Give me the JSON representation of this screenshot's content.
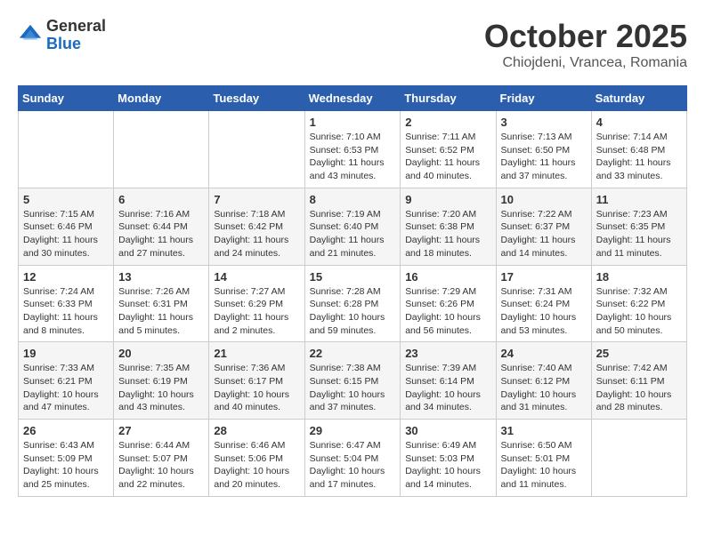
{
  "header": {
    "logo_general": "General",
    "logo_blue": "Blue",
    "month_title": "October 2025",
    "location": "Chiojdeni, Vrancea, Romania"
  },
  "weekdays": [
    "Sunday",
    "Monday",
    "Tuesday",
    "Wednesday",
    "Thursday",
    "Friday",
    "Saturday"
  ],
  "weeks": [
    [
      {
        "day": "",
        "info": ""
      },
      {
        "day": "",
        "info": ""
      },
      {
        "day": "",
        "info": ""
      },
      {
        "day": "1",
        "info": "Sunrise: 7:10 AM\nSunset: 6:53 PM\nDaylight: 11 hours\nand 43 minutes."
      },
      {
        "day": "2",
        "info": "Sunrise: 7:11 AM\nSunset: 6:52 PM\nDaylight: 11 hours\nand 40 minutes."
      },
      {
        "day": "3",
        "info": "Sunrise: 7:13 AM\nSunset: 6:50 PM\nDaylight: 11 hours\nand 37 minutes."
      },
      {
        "day": "4",
        "info": "Sunrise: 7:14 AM\nSunset: 6:48 PM\nDaylight: 11 hours\nand 33 minutes."
      }
    ],
    [
      {
        "day": "5",
        "info": "Sunrise: 7:15 AM\nSunset: 6:46 PM\nDaylight: 11 hours\nand 30 minutes."
      },
      {
        "day": "6",
        "info": "Sunrise: 7:16 AM\nSunset: 6:44 PM\nDaylight: 11 hours\nand 27 minutes."
      },
      {
        "day": "7",
        "info": "Sunrise: 7:18 AM\nSunset: 6:42 PM\nDaylight: 11 hours\nand 24 minutes."
      },
      {
        "day": "8",
        "info": "Sunrise: 7:19 AM\nSunset: 6:40 PM\nDaylight: 11 hours\nand 21 minutes."
      },
      {
        "day": "9",
        "info": "Sunrise: 7:20 AM\nSunset: 6:38 PM\nDaylight: 11 hours\nand 18 minutes."
      },
      {
        "day": "10",
        "info": "Sunrise: 7:22 AM\nSunset: 6:37 PM\nDaylight: 11 hours\nand 14 minutes."
      },
      {
        "day": "11",
        "info": "Sunrise: 7:23 AM\nSunset: 6:35 PM\nDaylight: 11 hours\nand 11 minutes."
      }
    ],
    [
      {
        "day": "12",
        "info": "Sunrise: 7:24 AM\nSunset: 6:33 PM\nDaylight: 11 hours\nand 8 minutes."
      },
      {
        "day": "13",
        "info": "Sunrise: 7:26 AM\nSunset: 6:31 PM\nDaylight: 11 hours\nand 5 minutes."
      },
      {
        "day": "14",
        "info": "Sunrise: 7:27 AM\nSunset: 6:29 PM\nDaylight: 11 hours\nand 2 minutes."
      },
      {
        "day": "15",
        "info": "Sunrise: 7:28 AM\nSunset: 6:28 PM\nDaylight: 10 hours\nand 59 minutes."
      },
      {
        "day": "16",
        "info": "Sunrise: 7:29 AM\nSunset: 6:26 PM\nDaylight: 10 hours\nand 56 minutes."
      },
      {
        "day": "17",
        "info": "Sunrise: 7:31 AM\nSunset: 6:24 PM\nDaylight: 10 hours\nand 53 minutes."
      },
      {
        "day": "18",
        "info": "Sunrise: 7:32 AM\nSunset: 6:22 PM\nDaylight: 10 hours\nand 50 minutes."
      }
    ],
    [
      {
        "day": "19",
        "info": "Sunrise: 7:33 AM\nSunset: 6:21 PM\nDaylight: 10 hours\nand 47 minutes."
      },
      {
        "day": "20",
        "info": "Sunrise: 7:35 AM\nSunset: 6:19 PM\nDaylight: 10 hours\nand 43 minutes."
      },
      {
        "day": "21",
        "info": "Sunrise: 7:36 AM\nSunset: 6:17 PM\nDaylight: 10 hours\nand 40 minutes."
      },
      {
        "day": "22",
        "info": "Sunrise: 7:38 AM\nSunset: 6:15 PM\nDaylight: 10 hours\nand 37 minutes."
      },
      {
        "day": "23",
        "info": "Sunrise: 7:39 AM\nSunset: 6:14 PM\nDaylight: 10 hours\nand 34 minutes."
      },
      {
        "day": "24",
        "info": "Sunrise: 7:40 AM\nSunset: 6:12 PM\nDaylight: 10 hours\nand 31 minutes."
      },
      {
        "day": "25",
        "info": "Sunrise: 7:42 AM\nSunset: 6:11 PM\nDaylight: 10 hours\nand 28 minutes."
      }
    ],
    [
      {
        "day": "26",
        "info": "Sunrise: 6:43 AM\nSunset: 5:09 PM\nDaylight: 10 hours\nand 25 minutes."
      },
      {
        "day": "27",
        "info": "Sunrise: 6:44 AM\nSunset: 5:07 PM\nDaylight: 10 hours\nand 22 minutes."
      },
      {
        "day": "28",
        "info": "Sunrise: 6:46 AM\nSunset: 5:06 PM\nDaylight: 10 hours\nand 20 minutes."
      },
      {
        "day": "29",
        "info": "Sunrise: 6:47 AM\nSunset: 5:04 PM\nDaylight: 10 hours\nand 17 minutes."
      },
      {
        "day": "30",
        "info": "Sunrise: 6:49 AM\nSunset: 5:03 PM\nDaylight: 10 hours\nand 14 minutes."
      },
      {
        "day": "31",
        "info": "Sunrise: 6:50 AM\nSunset: 5:01 PM\nDaylight: 10 hours\nand 11 minutes."
      },
      {
        "day": "",
        "info": ""
      }
    ]
  ]
}
